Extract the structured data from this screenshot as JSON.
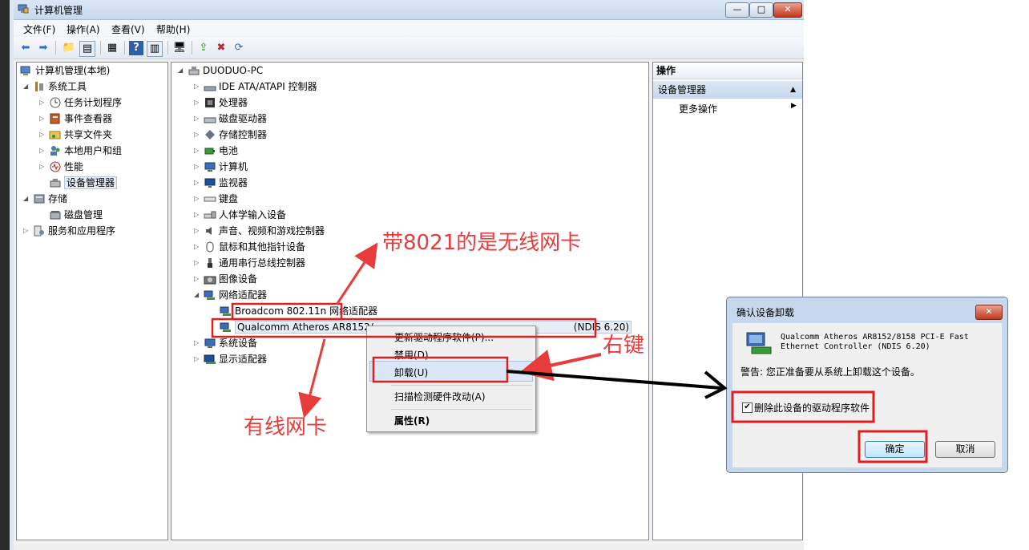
{
  "window": {
    "title": "计算机管理",
    "controls": {
      "minimize": "—",
      "maximize": "□",
      "close": "✕"
    }
  },
  "menu": [
    "文件(F)",
    "操作(A)",
    "查看(V)",
    "帮助(H)"
  ],
  "left_tree": {
    "root": "计算机管理(本地)",
    "system_tools": "系统工具",
    "task_scheduler": "任务计划程序",
    "event_viewer": "事件查看器",
    "shared_folders": "共享文件夹",
    "local_users": "本地用户和组",
    "performance": "性能",
    "device_manager": "设备管理器",
    "storage": "存储",
    "disk_management": "磁盘管理",
    "services_apps": "服务和应用程序"
  },
  "device_tree": {
    "root": "DUODUO-PC",
    "ide": "IDE ATA/ATAPI 控制器",
    "processor": "处理器",
    "disk": "磁盘驱动器",
    "storage_ctrl": "存储控制器",
    "battery": "电池",
    "computer": "计算机",
    "monitor": "监视器",
    "keyboard": "键盘",
    "hid": "人体学输入设备",
    "sound": "声音、视频和游戏控制器",
    "mouse": "鼠标和其他指针设备",
    "usb": "通用串行总线控制器",
    "imaging": "图像设备",
    "network": "网络适配器",
    "broadcom": "Broadcom 802.11n 网络适配器",
    "qualcomm_left": "Qualcomm Atheros AR8152/",
    "qualcomm_right": "(NDIS 6.20)",
    "system_devices": "系统设备",
    "display": "显示适配器"
  },
  "context_menu": {
    "update": "更新驱动程序软件(P)...",
    "disable": "禁用(D)",
    "uninstall": "卸载(U)",
    "scan": "扫描检测硬件改动(A)",
    "properties": "属性(R)"
  },
  "actions": {
    "header": "操作",
    "section": "设备管理器",
    "more": "更多操作"
  },
  "dialog": {
    "title": "确认设备卸载",
    "close": "✕",
    "device_line1": "Qualcomm Atheros AR8152/8158 PCI-E Fast",
    "device_line2": "Ethernet Controller (NDIS 6.20)",
    "warning": "警告: 您正准备要从系统上卸载这个设备。",
    "checkbox_label": "删除此设备的驱动程序软件",
    "checkbox_checked": true,
    "ok": "确定",
    "cancel": "取消"
  },
  "annotations": {
    "wireless": "带8021的是无线网卡",
    "right_click": "右键",
    "wired": "有线网卡"
  },
  "colors": {
    "annotation": "#e83b3b",
    "highlight_box": "#e02020"
  }
}
